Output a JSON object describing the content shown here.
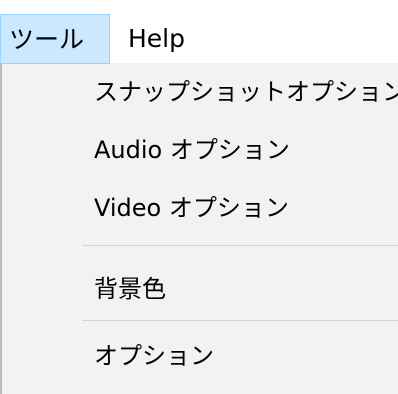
{
  "menubar": {
    "tools_label": "ツール",
    "help_label": "Help"
  },
  "menu": {
    "items": [
      {
        "label": "スナップショットオプション"
      },
      {
        "label": "Audio オプション"
      },
      {
        "label": "Video オプション"
      },
      {
        "label": "背景色"
      },
      {
        "label": "オプション"
      }
    ]
  },
  "colors": {
    "selected_bg": "#cce8ff",
    "selected_border": "#99d1ff",
    "menu_bg": "#f2f2f2"
  }
}
